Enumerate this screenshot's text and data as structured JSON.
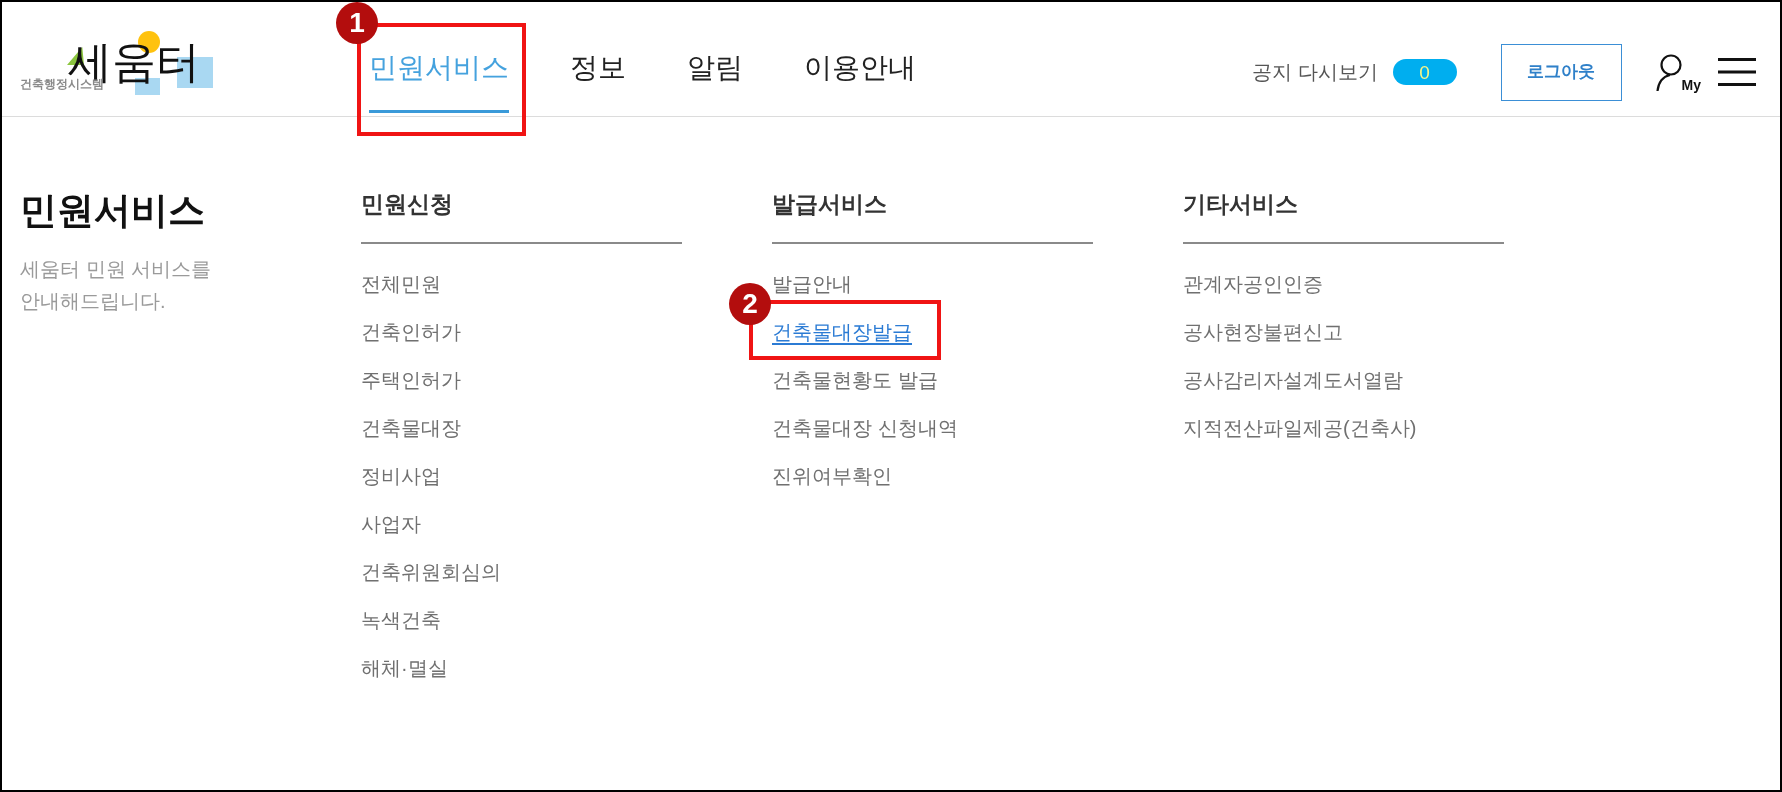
{
  "logo": {
    "wordmark": "세움터",
    "tagline": "건축행정시스템"
  },
  "nav": [
    {
      "label": "민원서비스",
      "selected": true,
      "annotation": "1"
    },
    {
      "label": "정보",
      "selected": false
    },
    {
      "label": "알림",
      "selected": false
    },
    {
      "label": "이용안내",
      "selected": false
    }
  ],
  "header_tools": {
    "notice_replay": {
      "label": "공지 다시보기",
      "count": "0"
    },
    "logout_button": "로그아웃",
    "my_page": {
      "label": "My"
    }
  },
  "section": {
    "title": "민원서비스",
    "description": "세움터 민원 서비스를 안내해드립니다."
  },
  "menu_columns": [
    {
      "heading": "민원신청",
      "items": [
        {
          "label": "전체민원",
          "selected": false
        },
        {
          "label": "건축인허가",
          "selected": false
        },
        {
          "label": "주택인허가",
          "selected": false
        },
        {
          "label": "건축물대장",
          "selected": false
        },
        {
          "label": "정비사업",
          "selected": false
        },
        {
          "label": "사업자",
          "selected": false
        },
        {
          "label": "건축위원회심의",
          "selected": false
        },
        {
          "label": "녹색건축",
          "selected": false
        },
        {
          "label": "해체·멸실",
          "selected": false
        }
      ]
    },
    {
      "heading": "발급서비스",
      "items": [
        {
          "label": "발급안내",
          "selected": false
        },
        {
          "label": "건축물대장발급",
          "selected": true,
          "annotation": "2"
        },
        {
          "label": "건축물현황도 발급",
          "selected": false
        },
        {
          "label": "건축물대장 신청내역",
          "selected": false
        },
        {
          "label": "진위여부확인",
          "selected": false
        }
      ]
    },
    {
      "heading": "기타서비스",
      "items": [
        {
          "label": "관계자공인인증",
          "selected": false
        },
        {
          "label": "공사현장불편신고",
          "selected": false
        },
        {
          "label": "공사감리자설계도서열람",
          "selected": false
        },
        {
          "label": "지적전산파일제공(건축사)",
          "selected": false
        }
      ]
    }
  ]
}
